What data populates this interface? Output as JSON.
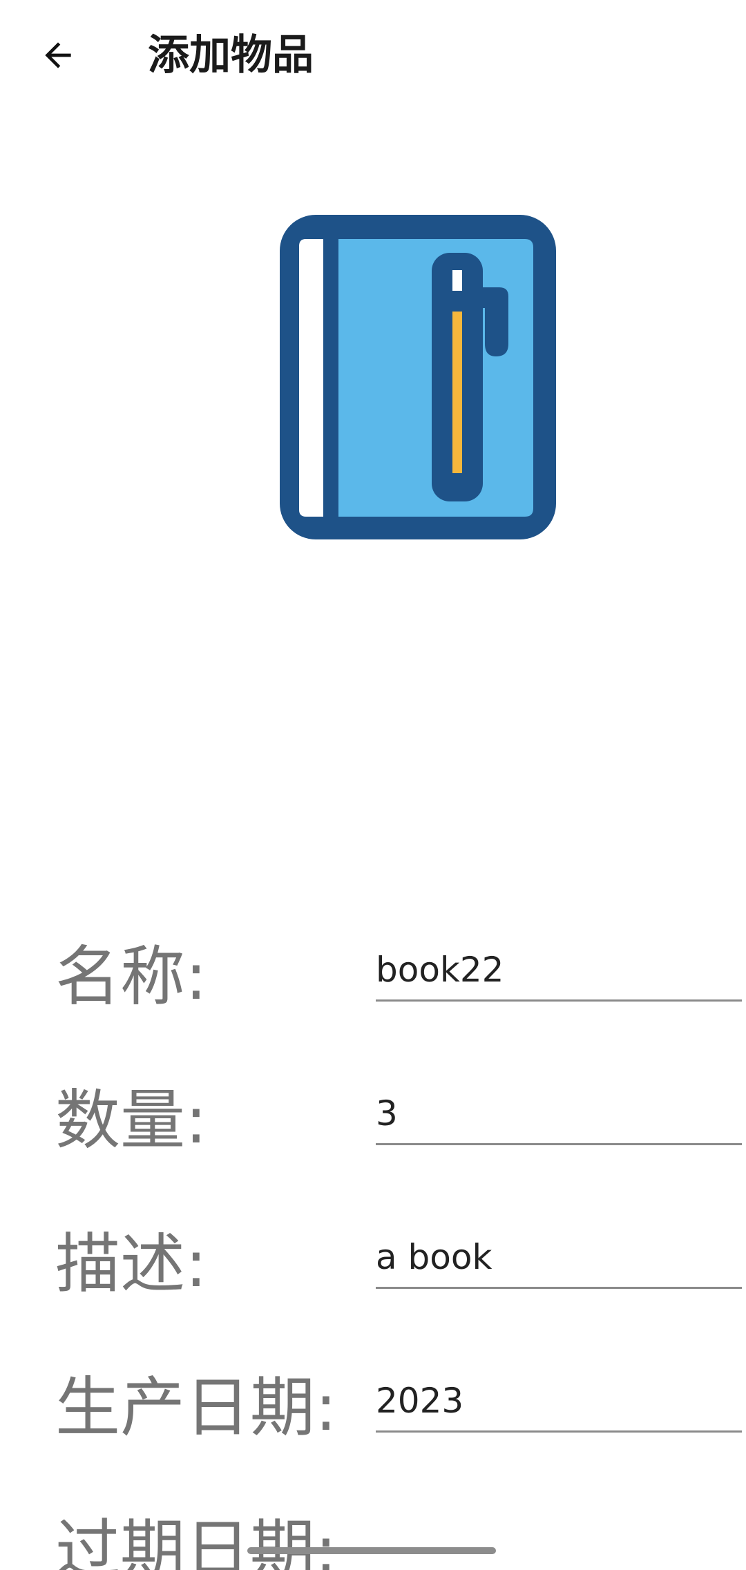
{
  "header": {
    "back_icon": "arrow-left-icon",
    "title": "添加物品"
  },
  "item_image": {
    "icon": "notebook-with-pen-icon",
    "colors": {
      "outline": "#1e5288",
      "cover": "#5bb8ea",
      "pages": "#ffffff",
      "pen_stripe": "#f6b73c"
    }
  },
  "form": {
    "fields": [
      {
        "label": "名称:",
        "value": "book22"
      },
      {
        "label": "数量:",
        "value": "3"
      },
      {
        "label": "描述:",
        "value": "a book"
      },
      {
        "label": "生产日期:",
        "value": "2023"
      }
    ],
    "next_label_partial": "过期日期:"
  },
  "colors": {
    "label": "#757575",
    "input_text": "#222222",
    "underline": "#8a8a8a"
  }
}
